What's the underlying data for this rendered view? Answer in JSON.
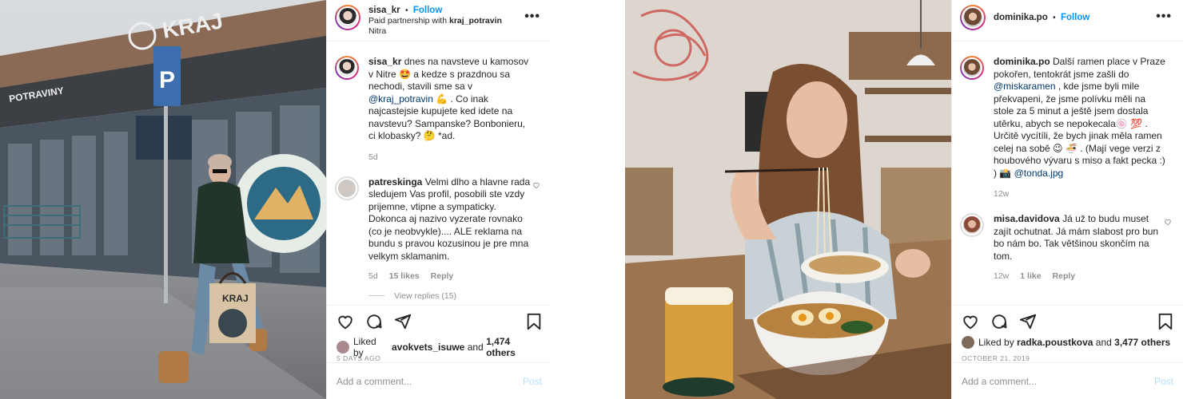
{
  "post1": {
    "username": "sisa_kr",
    "follow_label": "Follow",
    "partner_prefix": "Paid partnership with",
    "partner_name": "kraj_potravin",
    "location": "Nitra",
    "more_label": "•••",
    "photo_sign_main": "KRAJ",
    "photo_sign_store": "POTRAVINY",
    "photo_parking": "P",
    "photo_bag": "KRAJ",
    "caption": {
      "username": "sisa_kr",
      "text_a": "dnes na navsteve u kamosov v Nitre 🤩  a kedze s prazdnou sa nechodi, stavili sme sa v",
      "mention": "@kraj_potravin",
      "text_b": "💪 . Co inak najcastejsie kupujete ked idete na navstevu? Sampanske? Bonbonieru, ci klobasky? 🤔  *ad.",
      "time": "5d"
    },
    "comment": {
      "username": "patreskinga",
      "text": "Velmi dlho a hlavne rada sledujem Vas profil, posobili ste vzdy prijemne, vtipne a sympaticky. Dokonca aj nazivo vyzerate rovnako (co je neobvykle).... ALE reklama na bundu s pravou kozusinou je pre mna velkym sklamanim.",
      "time": "5d",
      "likes": "15 likes",
      "reply": "Reply",
      "view_replies": "View replies (15)"
    },
    "liked_by_prefix": "Liked by",
    "liked_by_user": "avokvets_isuwe",
    "liked_by_and": "and",
    "liked_by_others": "1,474 others",
    "date": "5 DAYS AGO",
    "add_comment_placeholder": "Add a comment...",
    "post_label": "Post"
  },
  "post2": {
    "username": "dominika.po",
    "follow_label": "Follow",
    "more_label": "•••",
    "caption": {
      "username": "dominika.po",
      "text_a": "Další ramen place v Praze pokořen, tentokrát jsme zašli do",
      "mention": "@miskaramen",
      "text_b": ", kde jsme byli mile překvapeni, že jsme polívku měli na stole za 5 minut a ještě jsem dostala utěrku, abych se nepokecala🍥 💯 . Určitě vycítíli, že bych jinak měla ramen celej na sobě 😉 🍜 . (Mají vege verzi z houbového vývaru s miso a fakt pecka :) ) 📸",
      "mention2": "@tonda.jpg",
      "time": "12w"
    },
    "comment": {
      "username": "misa.davidova",
      "text": "Já už to budu muset zajít ochutnat. Já mám slabost pro bun bo nám bo. Tak většinou skončím na tom.",
      "time": "12w",
      "likes": "1 like",
      "reply": "Reply"
    },
    "liked_by_prefix": "Liked by",
    "liked_by_user": "radka.poustkova",
    "liked_by_and": "and",
    "liked_by_others": "3,477 others",
    "date": "OCTOBER 21, 2019",
    "add_comment_placeholder": "Add a comment...",
    "post_label": "Post"
  }
}
